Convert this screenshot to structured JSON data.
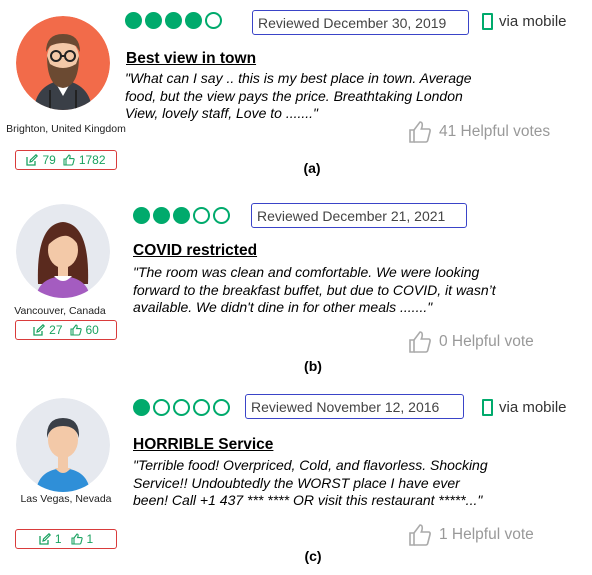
{
  "reviews": [
    {
      "location": "Brighton, United Kingdom",
      "contributions": "79",
      "helpful_count": "1782",
      "rating": 4,
      "rating_max": 5,
      "date": "Reviewed December 30, 2019",
      "via": "via mobile",
      "title": "Best view in town",
      "body_lines": [
        "\"What can I say .. this is my best place in town. Average",
        "food, but the view pays the price. Breathtaking London",
        "View, lovely staff, Love to .......\""
      ],
      "helpful_votes": "41 Helpful votes",
      "caption": "(a)"
    },
    {
      "location": "Vancouver, Canada",
      "contributions": "27",
      "helpful_count": "60",
      "rating": 3,
      "rating_max": 5,
      "date": "Reviewed December 21, 2021",
      "via": "",
      "title": "COVID restricted",
      "body_lines": [
        "\"The room was clean and comfortable. We were looking",
        "forward to the breakfast buffet, but due to COVID, it wasn’t",
        "available. We didn't dine in for other meals .......\""
      ],
      "helpful_votes": "0 Helpful vote",
      "caption": "(b)"
    },
    {
      "location": "Las Vegas, Nevada",
      "contributions": "1",
      "helpful_count": "1",
      "rating": 1,
      "rating_max": 5,
      "date": "Reviewed November 12, 2016",
      "via": "via mobile",
      "title": "HORRIBLE Service",
      "body_lines": [
        "\"Terrible food! Overpriced, Cold, and flavorless. Shocking",
        "Service!! Undoubtedly the WORST place I have ever",
        "been! Call +1 437 ***  **** OR visit this restaurant *****...\""
      ],
      "helpful_votes": "1 Helpful vote",
      "caption": "(c)"
    }
  ],
  "colors": {
    "bubble_green": "#00aa6c",
    "stats_green": "#1aa260",
    "stats_border": "#d93b3b",
    "date_border": "#3a44c8",
    "helpful_gray": "#999999"
  },
  "icons": {
    "stats_contrib": "edit-icon",
    "stats_helpful": "thumbs-up-icon",
    "mobile": "mobile-phone-icon",
    "helpful": "thumbs-up-icon"
  }
}
